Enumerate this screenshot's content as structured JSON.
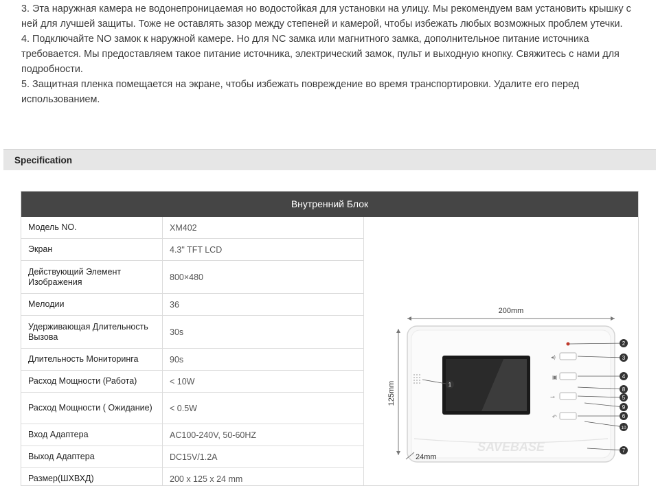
{
  "intro": [
    "3. Эта наружная камера не водонепроницаемая но водостойкая для установки на улицу. Мы рекомендуем вам установить крышку с ней для лучшей защиты. Тоже не оставлять зазор между степеней и камерой, чтобы избежать любых возможных проблем утечки.",
    "4. Подключайте NO замок к наружной камере. Но для NC замка или магнитного замка, дополнительное питание источника требовается. Мы предоставляем такое питание источника, электрический замок, пульт и выходную кнопку. Свяжитесь с нами для подробности.",
    "5. Защитная пленка помещается на экране, чтобы избежать повреждение во время транспортировки. Удалите его перед использованием."
  ],
  "spec_title": "Specification",
  "table": {
    "header": "Внутренний Блок",
    "rows": [
      {
        "key": "Модель NO.",
        "value": "XM402"
      },
      {
        "key": "Экран",
        "value": "4.3\" TFT LCD"
      },
      {
        "key": "Действующий Элемент Изображения",
        "value": "800×480"
      },
      {
        "key": "Мелодии",
        "value": "36"
      },
      {
        "key": "Удерживающая Длительность Вызова",
        "value": "30s"
      },
      {
        "key": "Длительность Мониторинга",
        "value": "90s"
      },
      {
        "key": "Расход Мощности (Работа)",
        "value": "< 10W"
      },
      {
        "key": "Расход Мощности ( Ожидание)",
        "value": "< 0.5W"
      },
      {
        "key": "Вход Адаптера",
        "value": "AC100-240V, 50-60HZ"
      },
      {
        "key": "Выход Адаптера",
        "value": "DC15V/1.2A"
      },
      {
        "key": "Размер(ШХВХД)",
        "value": "200 x 125 x 24 mm"
      }
    ]
  },
  "diagram": {
    "width_label": "200mm",
    "height_label": "125mm",
    "depth_label": "24mm",
    "brand": "SAVEBASE",
    "callouts": [
      "1",
      "2",
      "3",
      "4",
      "5",
      "6",
      "7",
      "8",
      "9",
      "10"
    ]
  }
}
